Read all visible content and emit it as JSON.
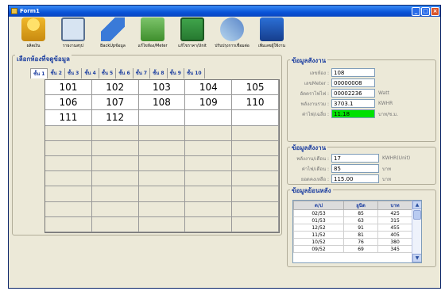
{
  "window": {
    "title": "Form1",
    "controls": [
      "_",
      "□",
      "×"
    ]
  },
  "toolbar": [
    {
      "label": "ผลิตเงิน",
      "icon": "coins-icon"
    },
    {
      "label": "รายงานสรุป",
      "icon": "monitor-icon"
    },
    {
      "label": "BackUpข้อมูล",
      "icon": "usb-drive-icon"
    },
    {
      "label": "แก้ไขห้อง/Meter",
      "icon": "network-icon"
    },
    {
      "label": "แก้ไขราคา/Unit",
      "icon": "banknote-icon"
    },
    {
      "label": "ปรับปรุงการเชื่อมต่อ",
      "icon": "plug-icon"
    },
    {
      "label": "เพิ่มเลขผู้ใช้งาน",
      "icon": "book-icon"
    }
  ],
  "room_panel": {
    "legend": "เลือกห้องที่จดูข้อมูล",
    "tabs": [
      "ชั้น 1",
      "ชั้น 2",
      "ชั้น 3",
      "ชั้น 4",
      "ชั้น 5",
      "ชั้น 6",
      "ชั้น 7",
      "ชั้น 8",
      "ชั้น 9",
      "ชั้น 10"
    ],
    "active_tab": "ชั้น 1",
    "rooms": [
      [
        "101",
        "102",
        "103",
        "104",
        "105"
      ],
      [
        "106",
        "107",
        "108",
        "109",
        "110"
      ],
      [
        "111",
        "112",
        "",
        "",
        ""
      ],
      [
        "",
        "",
        "",
        "",
        ""
      ],
      [
        "",
        "",
        "",
        "",
        ""
      ],
      [
        "",
        "",
        "",
        "",
        ""
      ],
      [
        "",
        "",
        "",
        "",
        ""
      ],
      [
        "",
        "",
        "",
        "",
        ""
      ],
      [
        "",
        "",
        "",
        "",
        ""
      ],
      [
        "",
        "",
        "",
        "",
        ""
      ]
    ]
  },
  "info1": {
    "legend": "ข้อมูลสังงาน",
    "fields": [
      {
        "label": "เลขห้อง :",
        "value": "108",
        "unit": ""
      },
      {
        "label": "เลขMeter :",
        "value": "00000008",
        "unit": ""
      },
      {
        "label": "อัตตราไฟไฟ :",
        "value": "00002236",
        "unit": "Watt"
      },
      {
        "label": "พลังงานรวม :",
        "value": "3703.1",
        "unit": "KWHR"
      },
      {
        "label": "ค่าไฟ/เฉลี่ย :",
        "value": "11.18",
        "unit": "บาท/ช.ม."
      }
    ],
    "highlight_color": "#00e000"
  },
  "info2": {
    "legend": "ข้อมูลสังงาน",
    "fields": [
      {
        "label": "พลังงาน/เดือน :",
        "value": "17",
        "unit": "KWHR(Unit)"
      },
      {
        "label": "ค่าไฟ/เดือน :",
        "value": "85",
        "unit": "บาท"
      },
      {
        "label": "ยอดคงเหลือ :",
        "value": "115.00",
        "unit": "บาท"
      }
    ]
  },
  "history": {
    "legend": "ข้อมูลย้อนหลัง",
    "columns": [
      "ด/ป",
      "ยูนิต",
      "บาท"
    ],
    "rows": [
      [
        "02/53",
        "85",
        "425"
      ],
      [
        "01/53",
        "63",
        "315"
      ],
      [
        "12/52",
        "91",
        "455"
      ],
      [
        "11/52",
        "81",
        "405"
      ],
      [
        "10/52",
        "76",
        "380"
      ],
      [
        "09/52",
        "69",
        "345"
      ]
    ]
  }
}
